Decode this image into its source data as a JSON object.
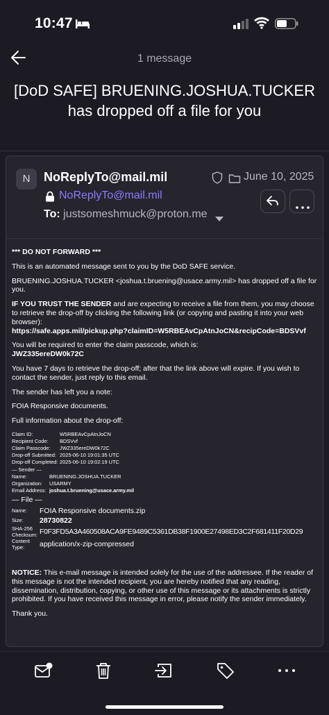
{
  "status_bar": {
    "time": "10:47"
  },
  "topbar": {
    "message_count": "1 message"
  },
  "subject": "[DoD SAFE] BRUENING.JOSHUA.TUCKER has dropped off a file for you",
  "email": {
    "avatar_letter": "N",
    "sender_name": "NoReplyTo@mail.mil",
    "sender_address": "NoReplyTo@mail.mil",
    "date": "June 10, 2025",
    "to_label": "To:",
    "to_address": "justsomeshmuck@proton.me"
  },
  "body": {
    "do_not_forward": "*** DO NOT FORWARD ***",
    "intro": "This is an automated message sent to you by the DoD SAFE service.",
    "dropped": "BRUENING.JOSHUA.TUCKER <joshua.t.bruening@usace.army.mil> has dropped off a file for you.",
    "trust_bold": "IF YOU TRUST THE SENDER",
    "trust_rest": " and are expecting to receive a file from them, you may choose to retrieve the drop-off by clicking the following link (or copying and pasting it into your web browser):",
    "link": "https://safe.apps.mil/pickup.php?claimID=W5RBEAvCpAtnJoCN&recipCode=BDSVvf",
    "passcode_intro": "You will be required to enter the claim passcode, which is:",
    "passcode": "JWZ335ereDW0k72C",
    "expiry": "You have 7 days to retrieve the drop-off; after that the link above will expire. If you wish to contact the sender, just reply to this email.",
    "note_intro": "The sender has left you a note:",
    "note": "FOIA Responsive documents.",
    "full_info": "Full information about the drop-off:",
    "claim_rows": [
      {
        "k": "Claim ID:",
        "v": "W5RBEAvCpAtnJoCN"
      },
      {
        "k": "Recipient Code:",
        "v": "BDSVvf"
      },
      {
        "k": "Claim Passcode:",
        "v": "JWZ335ereDW0k72C"
      },
      {
        "k": "Drop-off Submitted:",
        "v": "2025-06-10 19:01:35 UTC"
      },
      {
        "k": "Drop-off Completed:",
        "v": "2025-06-10 19:02:19 UTC"
      }
    ],
    "sender_section": "— Sender —",
    "sender_rows": [
      {
        "k": "Name:",
        "v": "BRUENING.JOSHUA.TUCKER"
      },
      {
        "k": "Organization:",
        "v": "USARMY"
      },
      {
        "k": "Email Address:",
        "v": "joshua.t.bruening@usace.army.mil"
      }
    ],
    "file_section": "— File —",
    "file_name_k": "Name:",
    "file_name_v": "FOIA Responsive documents.zip",
    "file_size_k": "Size:",
    "file_size_v": "28730822",
    "file_sha_k1": "SHA-256",
    "file_sha_k2": "Checksum:",
    "file_sha_v": "F0F3FD5A3A460508ACA9FE9489C5361DB38F1900E27498ED3C2F681411F20D29",
    "file_ct_k1": "Content",
    "file_ct_k2": "Type:",
    "file_ct_v": "application/x-zip-compressed",
    "notice_bold": "NOTICE:",
    "notice_rest": " This e-mail message is intended solely for the use of the addressee. If the reader of this message is not the intended recipient, you are hereby notified that any reading, dissemination, distribution, copying, or other use of this message or its attachments is strictly prohibited. If you have received this message in error, please notify the sender immediately.",
    "thanks": "Thank you."
  },
  "colors": {
    "background": "#1c1b24",
    "card": "#26252e",
    "accent": "#8b7cff"
  },
  "icons": [
    "bed-icon",
    "signal-icon",
    "wifi-icon",
    "battery-icon",
    "back-arrow-icon",
    "shield-icon",
    "folder-icon",
    "lock-icon",
    "chevron-down-icon",
    "reply-icon",
    "more-icon",
    "mark-unread-icon",
    "trash-icon",
    "move-icon",
    "label-icon",
    "more-horizontal-icon"
  ]
}
